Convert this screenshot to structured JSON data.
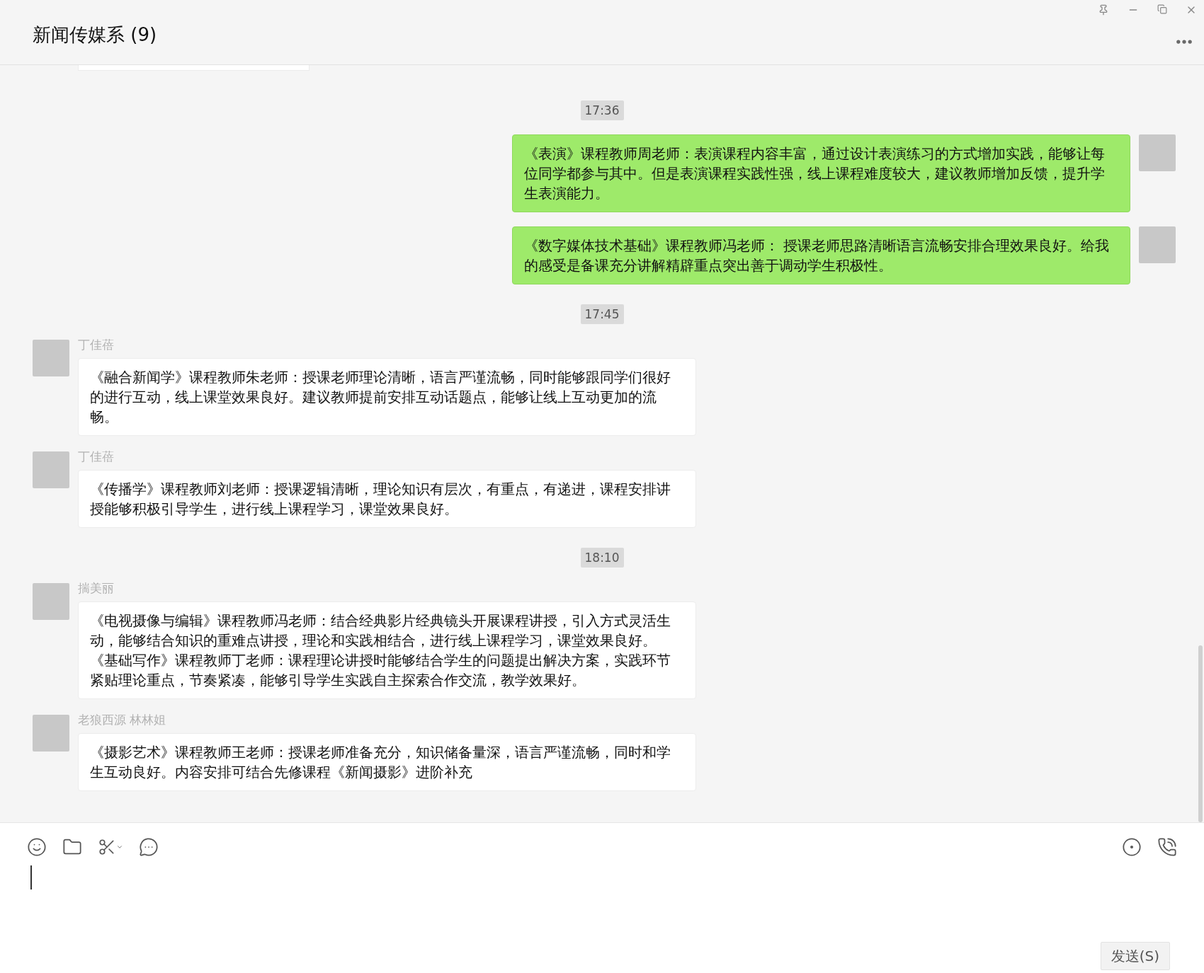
{
  "window": {
    "title": "新闻传媒系 (9)"
  },
  "messages": [
    {
      "kind": "time",
      "text": "17:36"
    },
    {
      "kind": "sent",
      "text": "《表演》课程教师周老师：表演课程内容丰富，通过设计表演练习的方式增加实践，能够让每位同学都参与其中。但是表演课程实践性强，线上课程难度较大，建议教师增加反馈，提升学生表演能力。"
    },
    {
      "kind": "sent",
      "text": "《数字媒体技术基础》课程教师冯老师： 授课老师思路清晰语言流畅安排合理效果良好。给我的感受是备课充分讲解精辟重点突出善于调动学生积极性。"
    },
    {
      "kind": "time",
      "text": "17:45"
    },
    {
      "kind": "received",
      "sender": "丁佳蓓",
      "text": "《融合新闻学》课程教师朱老师：授课老师理论清晰，语言严谨流畅，同时能够跟同学们很好的进行互动，线上课堂效果良好。建议教师提前安排互动话题点，能够让线上互动更加的流畅。"
    },
    {
      "kind": "received",
      "sender": "丁佳蓓",
      "text": "《传播学》课程教师刘老师：授课逻辑清晰，理论知识有层次，有重点，有递进，课程安排讲授能够积极引导学生，进行线上课程学习，课堂效果良好。"
    },
    {
      "kind": "time",
      "text": "18:10"
    },
    {
      "kind": "received",
      "sender": "揣美丽",
      "paragraphs": [
        "《电视摄像与编辑》课程教师冯老师：结合经典影片经典镜头开展课程讲授，引入方式灵活生动，能够结合知识的重难点讲授，理论和实践相结合，进行线上课程学习，课堂效果良好。",
        "《基础写作》课程教师丁老师：课程理论讲授时能够结合学生的问题提出解决方案，实践环节紧贴理论重点，节奏紧凑，能够引导学生实践自主探索合作交流，教学效果好。"
      ]
    },
    {
      "kind": "received",
      "sender": "老狼西源 林林姐",
      "text": "《摄影艺术》课程教师王老师：授课老师准备充分，知识储备量深，语言严谨流畅，同时和学生互动良好。内容安排可结合先修课程《新闻摄影》进阶补充"
    }
  ],
  "composer": {
    "send_button": "发送(S)"
  }
}
